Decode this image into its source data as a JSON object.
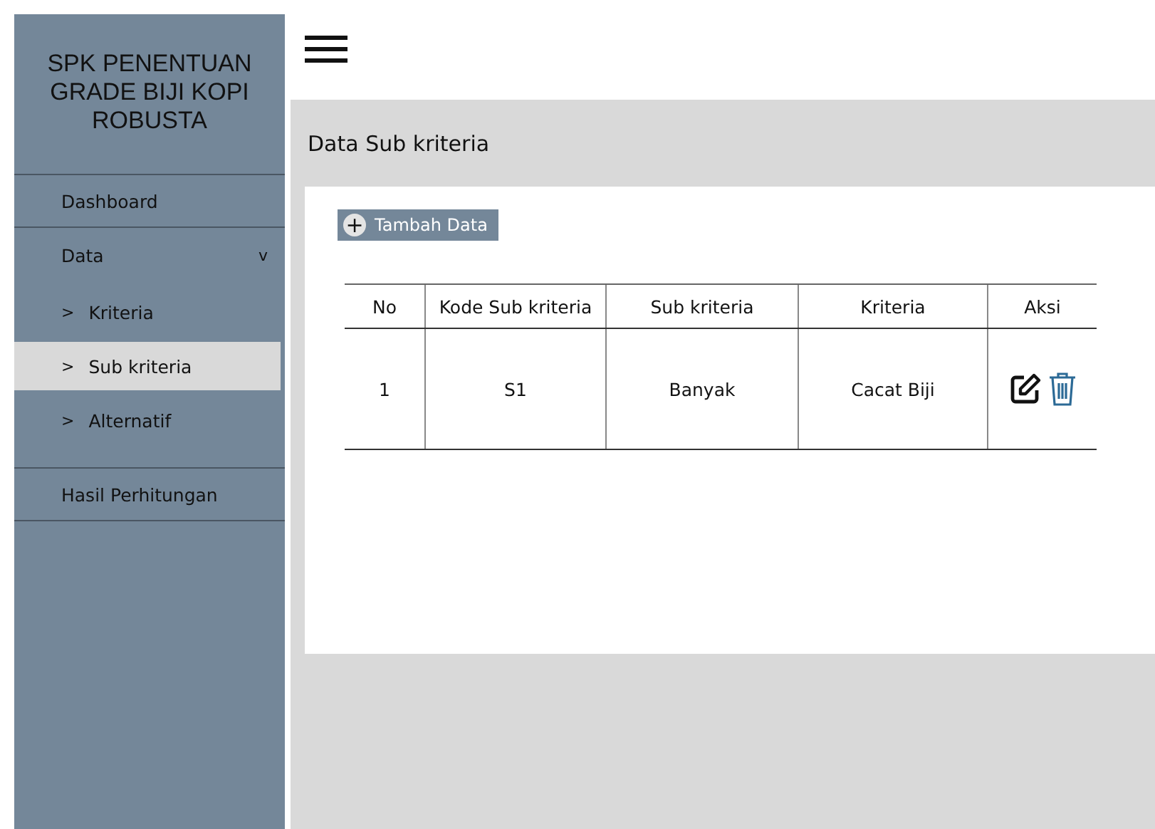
{
  "sidebar": {
    "title": "SPK PENENTUAN GRADE BIJI KOPI ROBUSTA",
    "items": [
      {
        "label": "Dashboard",
        "kind": "item"
      },
      {
        "label": "Data",
        "kind": "group",
        "expanded": true,
        "toggle": "v",
        "children": [
          {
            "label": "Kriteria",
            "marker": ">",
            "selected": false
          },
          {
            "label": "Sub kriteria",
            "marker": ">",
            "selected": true
          },
          {
            "label": "Alternatif",
            "marker": ">",
            "selected": false
          }
        ]
      },
      {
        "label": "Hasil Perhitungan",
        "kind": "item"
      }
    ]
  },
  "page_title": "Data Sub kriteria",
  "add_button": {
    "icon": "+",
    "label": "Tambah Data"
  },
  "table": {
    "columns": [
      "No",
      "Kode Sub kriteria",
      "Sub kriteria",
      "Kriteria",
      "Aksi"
    ],
    "rows": [
      {
        "cells": [
          "1",
          "S1",
          "Banyak",
          "Cacat Biji"
        ]
      }
    ]
  }
}
